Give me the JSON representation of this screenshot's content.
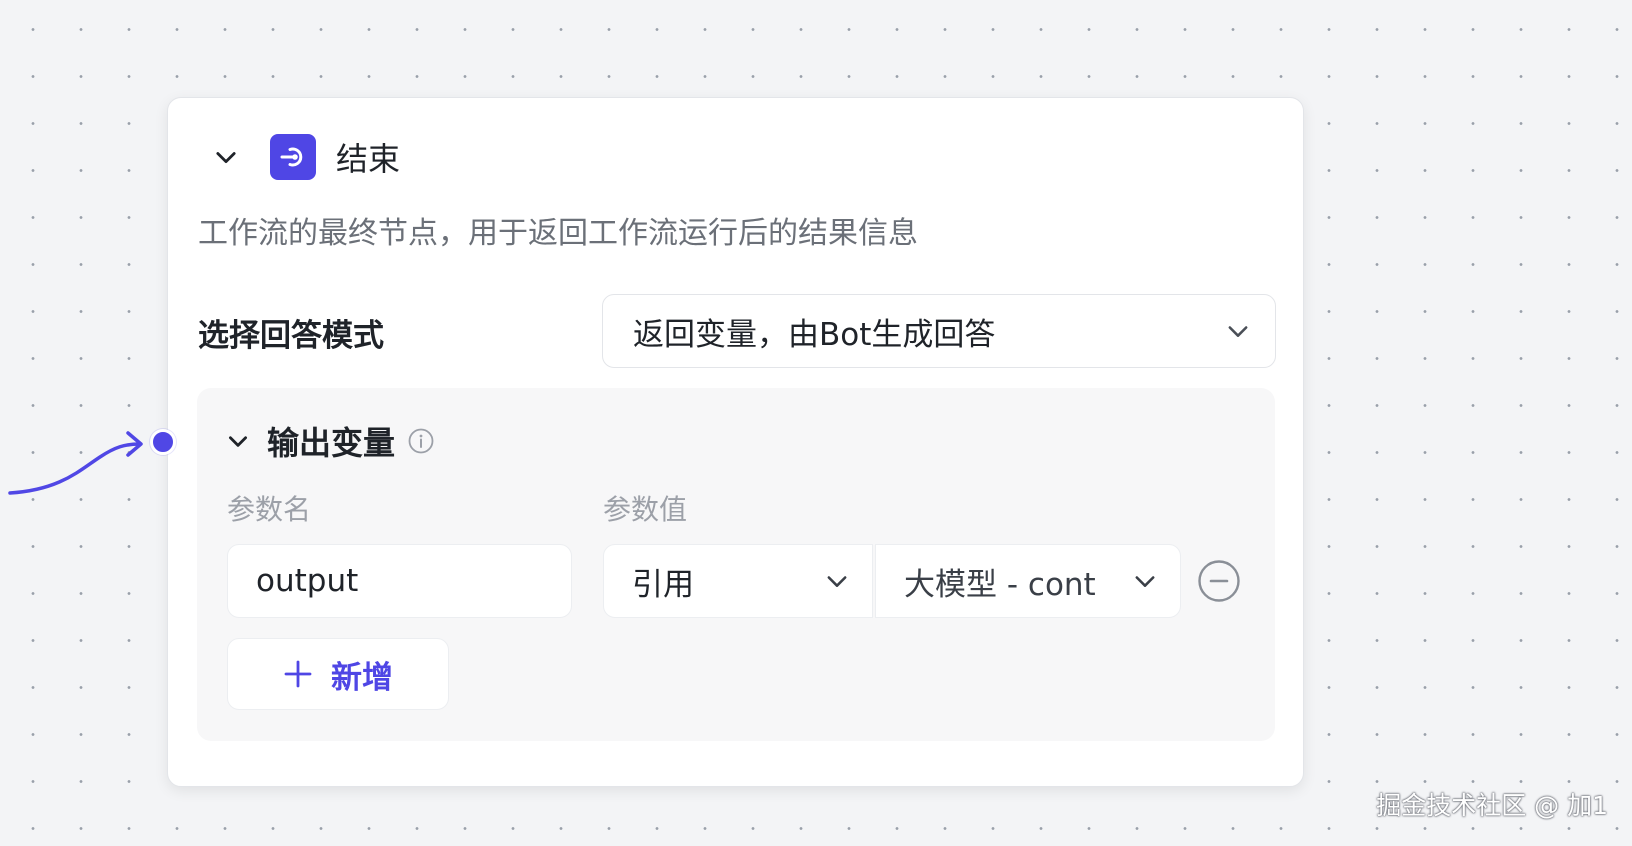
{
  "node": {
    "title": "结束",
    "description": "工作流的最终节点，用于返回工作流运行后的结果信息",
    "icon": "end-node-icon",
    "accent_color": "#4f46e5"
  },
  "answer_mode": {
    "label": "选择回答模式",
    "selected": "返回变量，由Bot生成回答"
  },
  "output_vars": {
    "title": "输出变量",
    "col_name": "参数名",
    "col_value": "参数值",
    "rows": [
      {
        "name": "output",
        "value_type": "引用",
        "value": "大模型 - cont"
      }
    ],
    "add_label": "新增"
  },
  "watermark": "掘金技术社区 @ 加1"
}
